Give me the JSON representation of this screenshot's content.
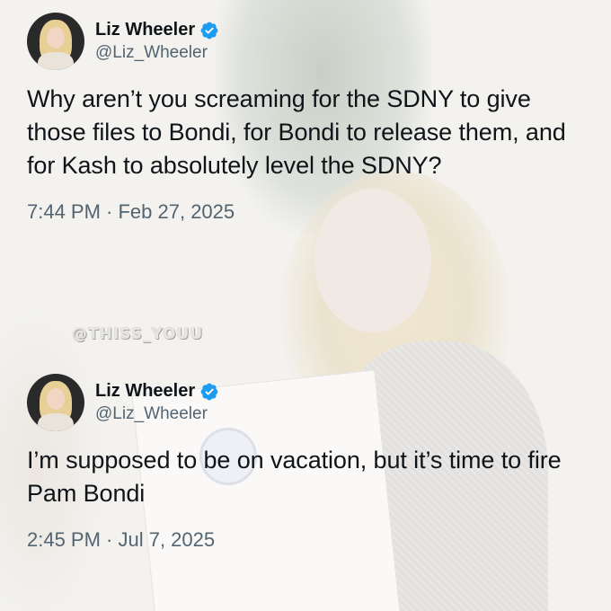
{
  "tweets": [
    {
      "author_name": "Liz Wheeler",
      "handle": "@Liz_Wheeler",
      "verified": true,
      "text": "Why aren’t you screaming for the SDNY to give those files to Bondi, for Bondi to release them, and for Kash to absolutely level the SDNY?",
      "timestamp": "7:44 PM · Feb 27, 2025"
    },
    {
      "author_name": "Liz Wheeler",
      "handle": "@Liz_Wheeler",
      "verified": true,
      "text": "I’m supposed to be on vacation, but it’s time to fire Pam Bondi",
      "timestamp": "2:45 PM · Jul 7, 2025"
    }
  ],
  "watermark": "@THISS_YOUU",
  "colors": {
    "verified_badge": "#1d9bf0",
    "text_primary": "#0f1419",
    "text_secondary": "#536471"
  },
  "icons": {
    "verified": "verified-badge-icon"
  }
}
